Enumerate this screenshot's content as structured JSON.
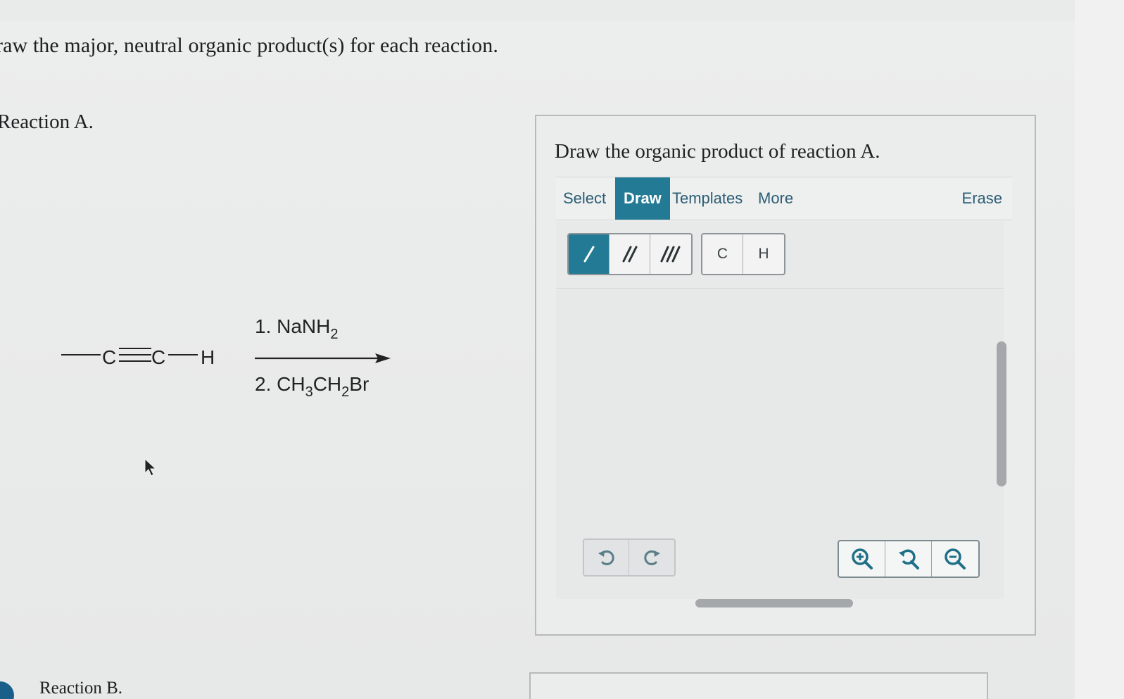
{
  "question": {
    "instructions": "raw the major, neutral organic product(s) for each reaction."
  },
  "reaction_a": {
    "label": "Reaction A.",
    "reactant": {
      "atom1": "C",
      "triple_bond": "≡",
      "atom2": "C",
      "atom3": "H"
    },
    "reagent_step1": {
      "prefix": "1. NaNH",
      "sub": "2"
    },
    "reagent_step2": {
      "prefix": "2. CH",
      "sub1": "3",
      "mid": "CH",
      "sub2": "2",
      "suffix": "Br"
    }
  },
  "reaction_b": {
    "label": "Reaction B."
  },
  "answer_panel": {
    "prompt": "Draw the organic product of reaction A.",
    "tabs": {
      "select": "Select",
      "draw": "Draw",
      "templates": "Templates",
      "more": "More",
      "erase": "Erase"
    },
    "active_tab": "Draw",
    "bond_tools": [
      "single-bond",
      "double-bond",
      "triple-bond"
    ],
    "active_bond_tool": "single-bond",
    "atom_buttons": {
      "carbon": "C",
      "hydrogen": "H"
    },
    "history_icons": [
      "undo-icon",
      "redo-icon"
    ],
    "zoom_icons": [
      "zoom-in-icon",
      "zoom-reset-icon",
      "zoom-out-icon"
    ]
  },
  "colors": {
    "accent": "#237a94",
    "icon": "#1e6f87",
    "text": "#1e2021",
    "background": "#e9eaea"
  }
}
